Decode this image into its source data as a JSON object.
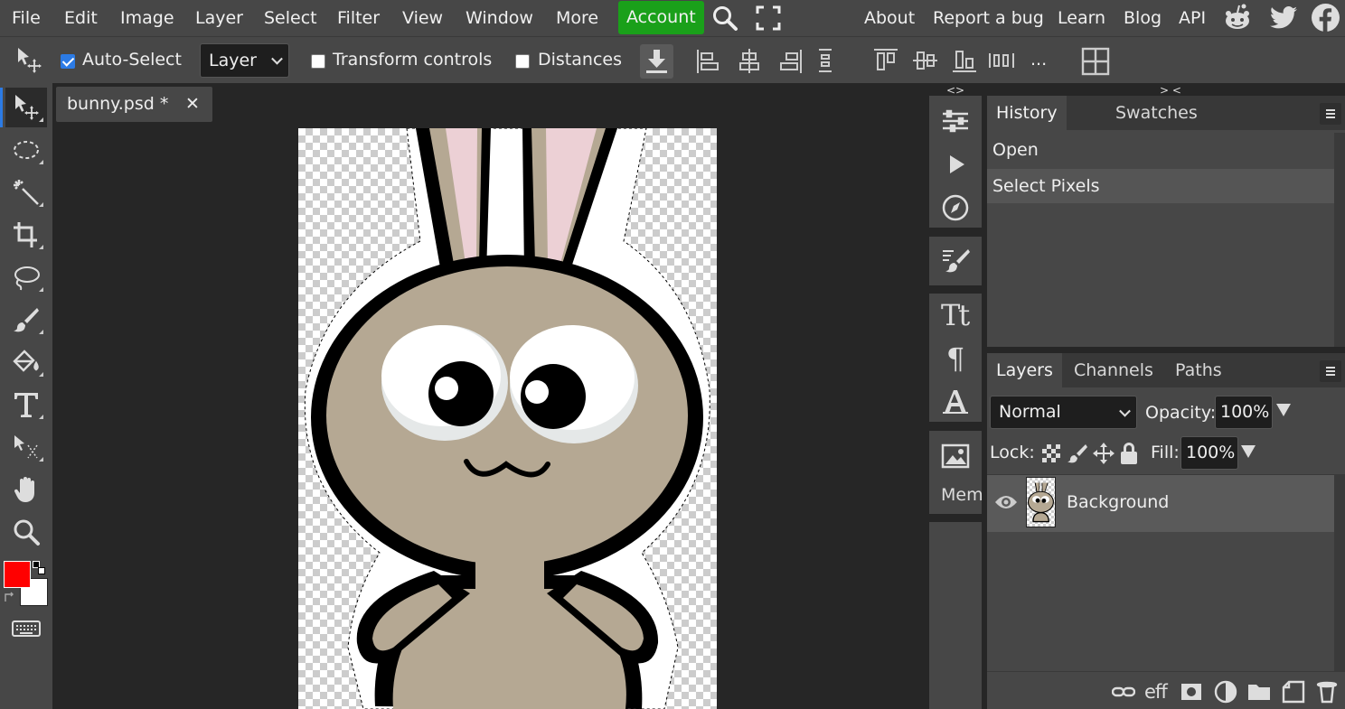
{
  "menubar": {
    "items": [
      "File",
      "Edit",
      "Image",
      "Layer",
      "Select",
      "Filter",
      "View",
      "Window",
      "More"
    ],
    "account": "Account",
    "links": [
      "About",
      "Report a bug",
      "Learn",
      "Blog",
      "API"
    ],
    "accent": "#1aa01a"
  },
  "options": {
    "auto_select_label": "Auto-Select",
    "auto_select_checked": true,
    "layer_select": "Layer",
    "transform_label": "Transform controls",
    "distances_label": "Distances",
    "more_label": "..."
  },
  "document": {
    "tab_title": "bunny.psd *",
    "close_glyph": "✕"
  },
  "toolbar": {
    "tools": [
      "move-tool-icon",
      "ellipse-select-icon",
      "magic-wand-icon",
      "crop-icon",
      "lasso-icon",
      "brush-icon",
      "paint-bucket-icon",
      "text-tool-icon",
      "path-select-icon",
      "hand-icon",
      "zoom-icon"
    ],
    "foreground_color": "#ff0000",
    "background_color": "#ffffff"
  },
  "iconcol": {
    "collapse_left": "<>",
    "collapse_right": "> <",
    "mem_label": "Mem"
  },
  "history": {
    "tabs": [
      "History",
      "Swatches"
    ],
    "entries": [
      "Open",
      "Select Pixels"
    ]
  },
  "layers": {
    "tabs": [
      "Layers",
      "Channels",
      "Paths"
    ],
    "blend_mode": "Normal",
    "opacity_label": "Opacity:",
    "opacity_value": "100%",
    "lock_label": "Lock:",
    "fill_label": "Fill:",
    "fill_value": "100%",
    "items": [
      {
        "name": "Background",
        "visible": true
      }
    ],
    "footer_icons": [
      "link-icon",
      "effects-icon",
      "mask-icon",
      "adjustment-icon",
      "folder-icon",
      "new-layer-icon",
      "trash-icon"
    ],
    "effects_glyph": "eff"
  }
}
